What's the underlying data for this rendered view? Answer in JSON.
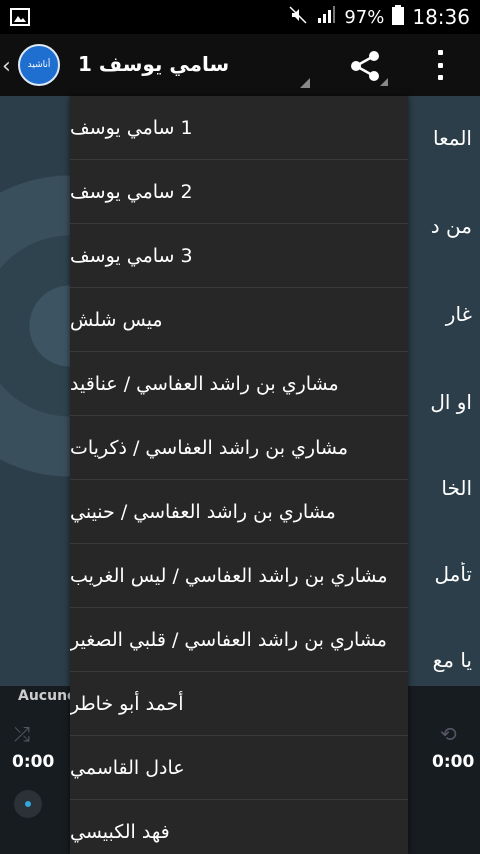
{
  "status_bar": {
    "battery_percent": "97%",
    "time": "18:36"
  },
  "action_bar": {
    "title": "1 سامي يوسف",
    "logo_text": "أناشيد"
  },
  "background_lines": [
    "المعا",
    "من د",
    "غار",
    "او ال",
    "الخا",
    "تأمل",
    "يا مع"
  ],
  "player": {
    "label": "Aucune",
    "time_left": "0:00",
    "time_right": "0:00",
    "progress": 0
  },
  "dropdown": {
    "items": [
      "1 سامي يوسف",
      "2 سامي يوسف",
      "3 سامي يوسف",
      "ميس شلش",
      "مشاري بن راشد العفاسي / عناقيد",
      "مشاري بن راشد العفاسي / ذكريات",
      "مشاري بن راشد العفاسي / حنيني",
      "مشاري بن راشد العفاسي / ليس الغريب",
      "مشاري بن راشد العفاسي / قلبي الصغير",
      "أحمد أبو خاطر",
      "عادل القاسمي",
      "فهد الكبيسي"
    ]
  },
  "colors": {
    "accent": "#1d7fc1",
    "dropdown_bg": "#272727"
  }
}
